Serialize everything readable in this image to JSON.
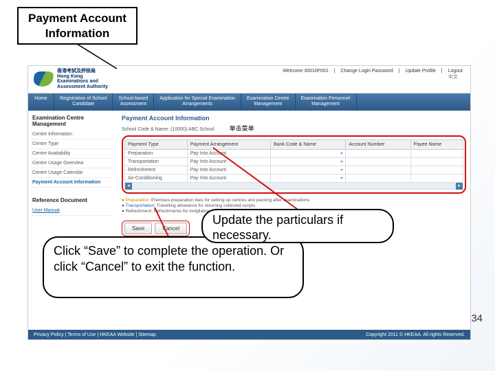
{
  "slide": {
    "title_line1": "Payment Account",
    "title_line2": "Information",
    "number": "34",
    "callout_upper": "Update the particulars if necessary.",
    "callout_lower": "Click “Save” to complete the operation. Or click “Cancel” to exit the function."
  },
  "app": {
    "logo": {
      "line1": "香港考試及評核局",
      "line2": "Hong Kong",
      "line3": "Examinations and",
      "line4": "Assessment Authority"
    },
    "header": {
      "welcome": "Welcome 30010F001",
      "links": [
        "Change Login Password",
        "Update Profile",
        "Logout"
      ],
      "lang_toggle": "中文"
    },
    "nav": {
      "home": "Home",
      "tabs": [
        "Registration of School\nCandidate",
        "School-based\nAssessment",
        "Application for Special Examination\nArrangements",
        "Examination Centre\nManagement",
        "Examination Personnel\nManagement"
      ]
    },
    "sidebar": {
      "title": "Examination Centre Management",
      "items": [
        "Centre Information",
        "Centre Type",
        "Centre Availability",
        "Centre Usage Overview",
        "Centre Usage Calendar",
        "Payment Account Information"
      ],
      "ref_title": "Reference Document",
      "ref_link": "User Manual"
    },
    "main": {
      "title": "Payment Account Information",
      "school_label": "School Code & Name:",
      "school_value": "(10000) ABC School",
      "chinese_hint": "单击菜单",
      "columns": [
        "Payment Type",
        "Payment Arrangement",
        "Bank Code & Name",
        "Account Number",
        "Payee Name"
      ],
      "rows": [
        {
          "type": "Preparation",
          "arr": "Pay Into Account"
        },
        {
          "type": "Transportation",
          "arr": "Pay Into Account"
        },
        {
          "type": "Refreshment",
          "arr": "Pay Into Account"
        },
        {
          "type": "Air-Conditioning",
          "arr": "Pay Into Account"
        }
      ],
      "notes": [
        {
          "label": "Preparation:",
          "text": "Premises preparation fees for setting up centres and packing after examinations"
        },
        {
          "label": "Transportation:",
          "text": "Travelling allowance for returning collected scripts"
        },
        {
          "label": "Refreshment:",
          "text": "Refreshments for invigilators"
        }
      ],
      "buttons": {
        "save": "Save",
        "cancel": "Cancel"
      }
    },
    "footer": {
      "left": "Privacy Policy | Terms of Use | HKEAA Website | Sitemap",
      "right": "Copyright 2011 © HKEAA. All rights Reserved."
    }
  }
}
